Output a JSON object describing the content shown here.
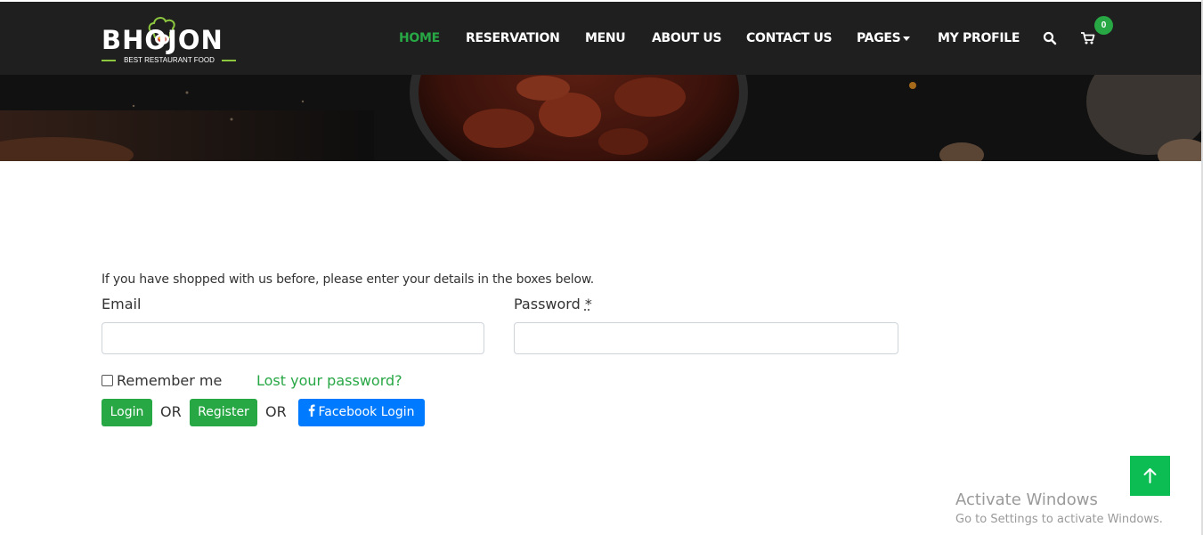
{
  "logo": {
    "name": "BHOJON",
    "tagline": "BEST RESTAURANT FOOD"
  },
  "nav": {
    "items": [
      {
        "label": "HOME",
        "active": true
      },
      {
        "label": "RESERVATION",
        "active": false
      },
      {
        "label": "MENU",
        "active": false
      },
      {
        "label": "ABOUT US",
        "active": false
      },
      {
        "label": "CONTACT US",
        "active": false
      },
      {
        "label": "PAGES",
        "active": false,
        "dropdown": true
      },
      {
        "label": "MY PROFILE",
        "active": false
      }
    ],
    "search_icon": "search-icon",
    "cart_icon": "cart-icon",
    "cart_count": "0"
  },
  "login": {
    "intro": "If you have shopped with us before, please enter your details in the boxes below.",
    "email_label": "Email",
    "password_label": "Password",
    "required_mark": "*",
    "email_value": "",
    "password_value": "",
    "remember_label": "Remember me",
    "lost_password": "Lost your password?",
    "login_button": "Login",
    "or_1": "OR",
    "register_button": "Register",
    "or_2": "OR",
    "facebook_button": "Facebook Login",
    "facebook_icon": "facebook-icon"
  },
  "scroll_top_icon": "arrow-up-icon",
  "watermark": {
    "title": "Activate Windows",
    "subtitle": "Go to Settings to activate Windows."
  },
  "colors": {
    "nav_bg": "#1f1f1f",
    "accent_green": "#28a745",
    "facebook_blue": "#007bff",
    "scroll_green": "#0bbd52"
  }
}
